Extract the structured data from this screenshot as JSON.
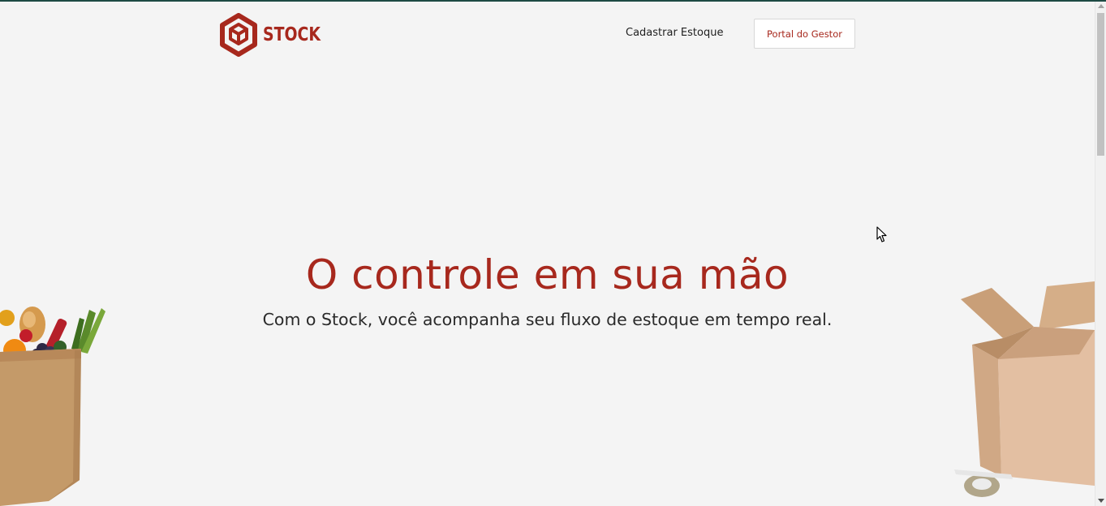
{
  "header": {
    "logo_text": "STOCK",
    "nav_link": "Cadastrar Estoque",
    "portal_button": "Portal do Gestor"
  },
  "hero": {
    "title": "O controle em sua mão",
    "subtitle": "Com o Stock, você acompanha seu fluxo de estoque em tempo real."
  },
  "colors": {
    "brand": "#a7281d",
    "background": "#f4f4f4",
    "text": "#2a2a2a",
    "top_border": "#1e4a44"
  },
  "icons": {
    "logo": "hexagon-cube-icon",
    "left_illustration": "grocery-bag-icon",
    "right_illustration": "cardboard-box-icon"
  }
}
